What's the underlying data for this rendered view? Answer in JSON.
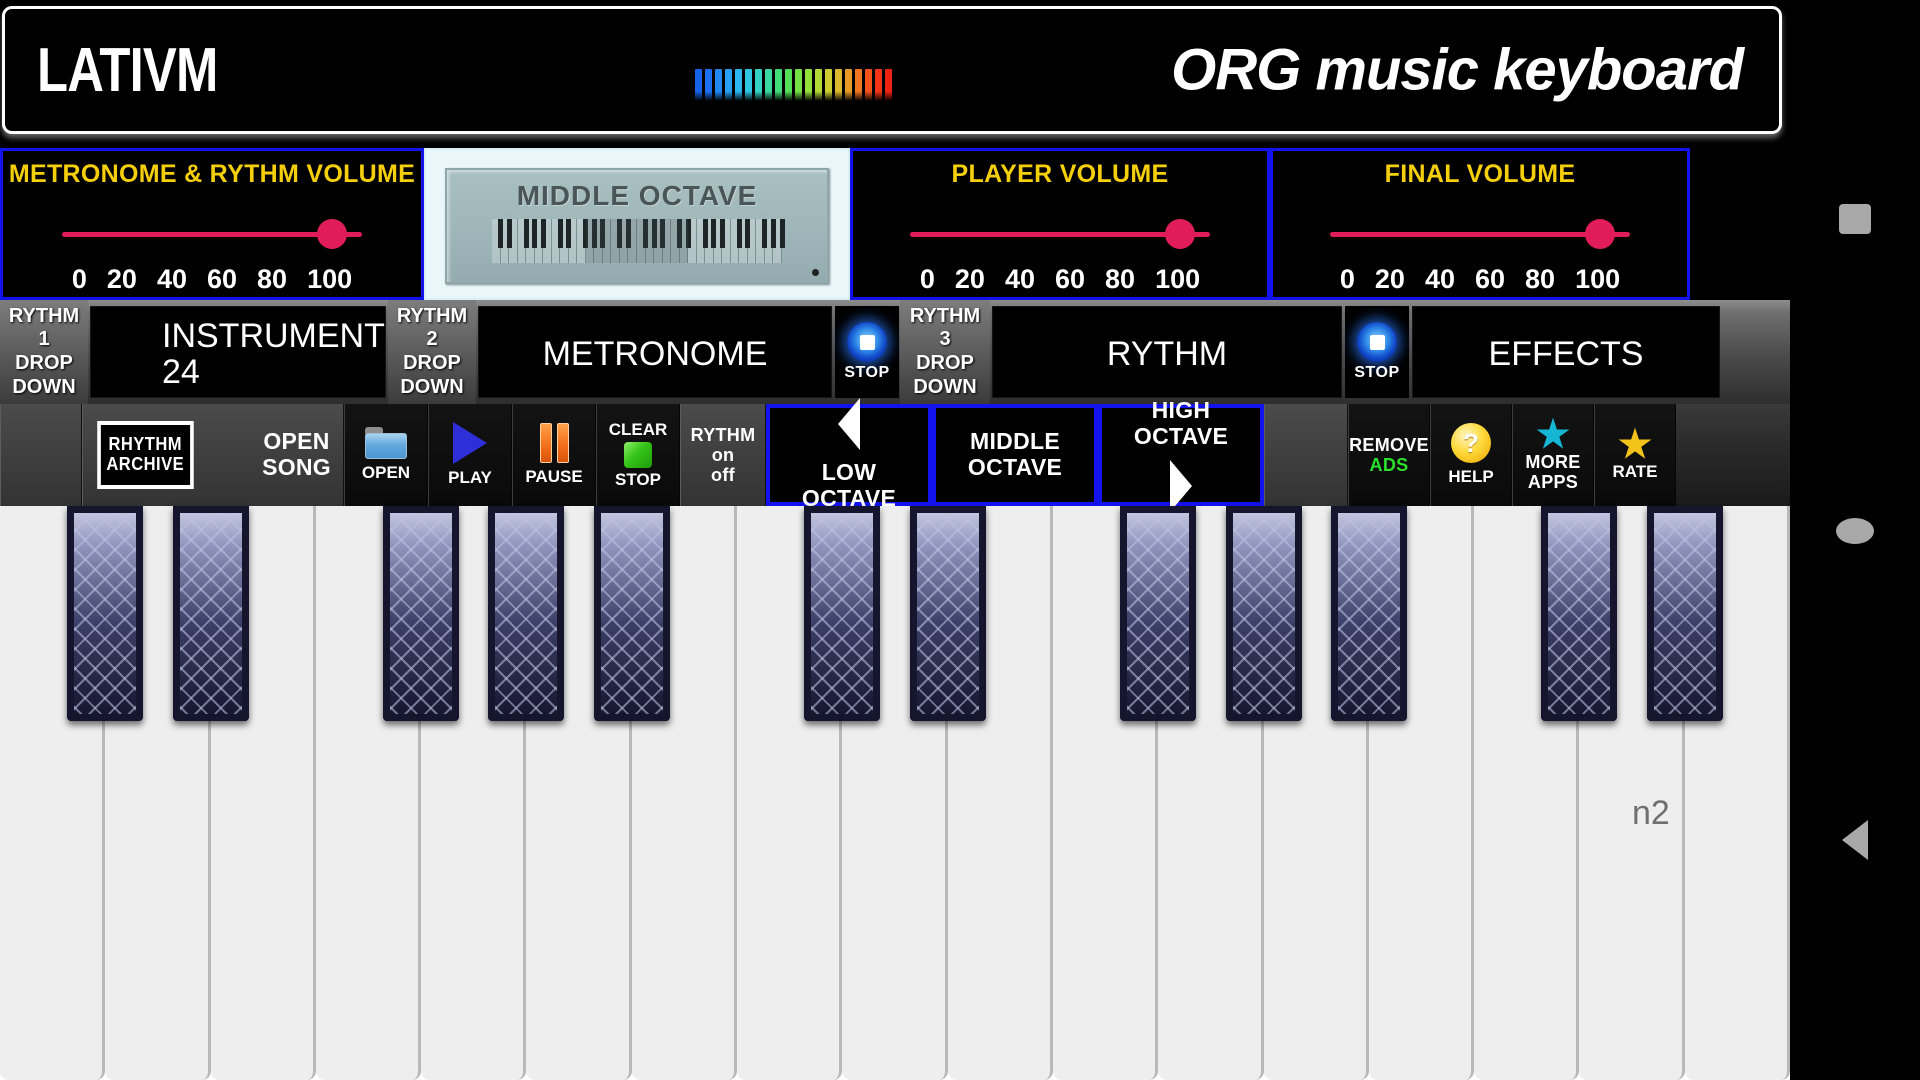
{
  "header": {
    "brand": "LATIVM",
    "app_title": "ORG music keyboard",
    "equalizer_colors": [
      "#1763e8",
      "#1b6ff0",
      "#2188f2",
      "#27a0f2",
      "#2bb6ef",
      "#2ec6e2",
      "#34d2c4",
      "#3ad79f",
      "#43da7a",
      "#55dd58",
      "#74e045",
      "#93e03b",
      "#b2d935",
      "#cbcd31",
      "#dcb82c",
      "#e89a27",
      "#ee7620",
      "#f2521a",
      "#f43416",
      "#ef2212"
    ]
  },
  "volumes": {
    "metronome": {
      "title": "METRONOME & RYTHM  VOLUME",
      "value": 90,
      "scale": [
        "0",
        "20",
        "40",
        "60",
        "80",
        "100"
      ]
    },
    "player": {
      "title": "PLAYER VOLUME",
      "value": 90,
      "scale": [
        "0",
        "20",
        "40",
        "60",
        "80",
        "100"
      ]
    },
    "final": {
      "title": "FINAL VOLUME",
      "value": 90,
      "scale": [
        "0",
        "20",
        "40",
        "60",
        "80",
        "100"
      ]
    },
    "slider_color": "#e01d5a",
    "title_color": "#f5cf0a",
    "border_color": "#1313ee"
  },
  "lcd": {
    "text": "MIDDLE OCTAVE"
  },
  "dropdown_row": {
    "rythm1_label": "RYTHM 1\nDROP\nDOWN",
    "rythm1_l1": "RYTHM 1",
    "rythm1_l2": "DROP",
    "rythm1_l3": "DOWN",
    "instrument_label": "INSTRUMENT",
    "instrument_value": "24",
    "rythm2_l1": "RYTHM 2",
    "rythm2_l2": "DROP",
    "rythm2_l3": "DOWN",
    "metronome_label": "METRONOME",
    "stop1_label": "STOP",
    "rythm3_l1": "RYTHM 3",
    "rythm3_l2": "DROP",
    "rythm3_l3": "DOWN",
    "rythm_label": "RYTHM",
    "stop2_label": "STOP",
    "effects_label": "EFFECTS"
  },
  "toolbar": {
    "rhythm_archive_l1": "RHYTHM",
    "rhythm_archive_l2": "ARCHIVE",
    "open_song_l1": "OPEN",
    "open_song_l2": "SONG",
    "open_label": "OPEN",
    "play_label": "PLAY",
    "pause_label": "PAUSE",
    "clear_label": "CLEAR",
    "stop_label": "STOP",
    "rythm_onoff_l1": "RYTHM",
    "rythm_onoff_l2": "on",
    "rythm_onoff_l3": "off",
    "low_octave_l1": "LOW",
    "low_octave_l2": "OCTAVE",
    "middle_octave_l1": "MIDDLE",
    "middle_octave_l2": "OCTAVE",
    "high_octave_l1": "HIGH",
    "high_octave_l2": "OCTAVE",
    "remove_ads_l1": "REMOVE",
    "remove_ads_l2": "ADS",
    "help_label": "HELP",
    "more_apps_l1": "MORE",
    "more_apps_l2": "APPS",
    "rate_label": "RATE",
    "selected_octave": "MIDDLE OCTAVE"
  },
  "keyboard": {
    "white_key_count": 17,
    "black_key_count": 12,
    "key_label": "n2"
  },
  "navbar": {
    "recents": "recents",
    "home": "home",
    "back": "back"
  }
}
